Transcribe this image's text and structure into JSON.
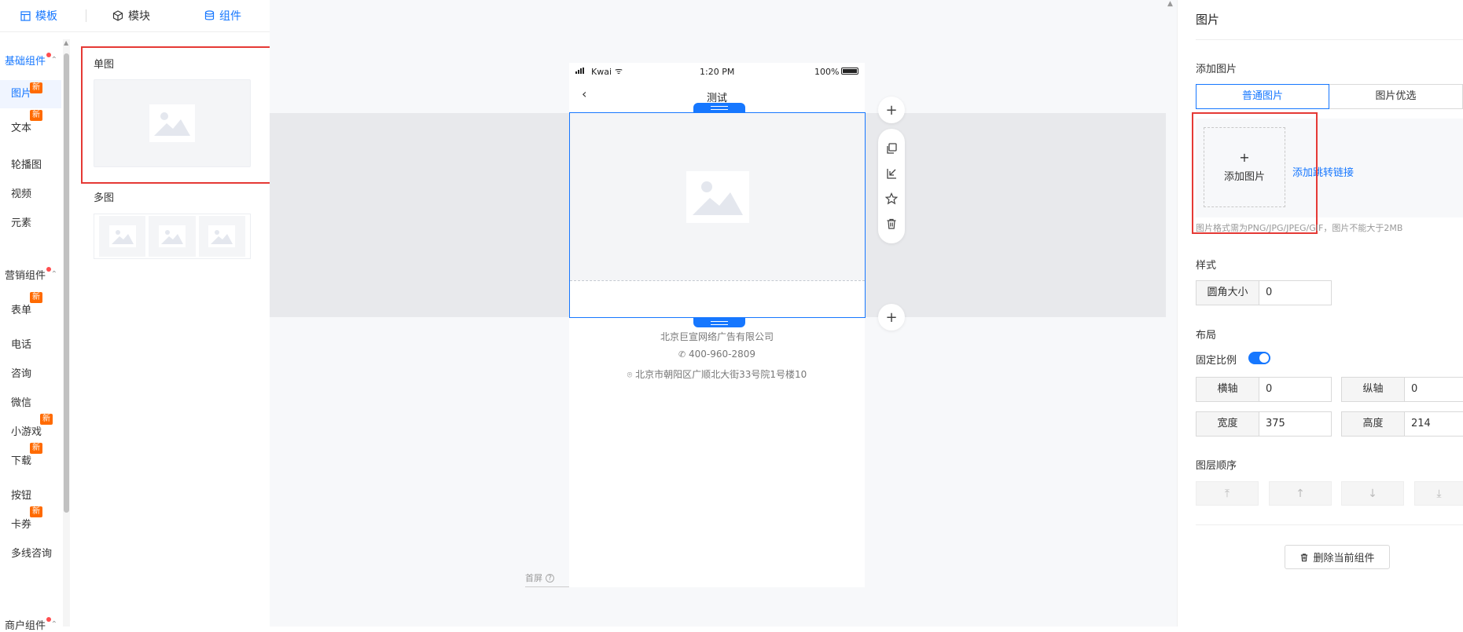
{
  "top_tabs": [
    {
      "label": "模板",
      "icon": "layout-icon"
    },
    {
      "label": "模块",
      "icon": "cube-icon"
    },
    {
      "label": "组件",
      "icon": "database-icon"
    }
  ],
  "left_nav": {
    "group1": "基础组件",
    "items1": [
      {
        "label": "图片",
        "badge": "新"
      },
      {
        "label": "文本",
        "badge": "新"
      },
      {
        "label": "轮播图"
      },
      {
        "label": "视频"
      },
      {
        "label": "元素"
      }
    ],
    "group2": "营销组件",
    "items2": [
      {
        "label": "表单",
        "badge": "新"
      },
      {
        "label": "电话"
      },
      {
        "label": "咨询"
      },
      {
        "label": "微信"
      },
      {
        "label": "小游戏",
        "badge": "新"
      },
      {
        "label": "下载",
        "badge": "新"
      },
      {
        "label": "按钮"
      },
      {
        "label": "卡券",
        "badge": "新"
      },
      {
        "label": "多线咨询"
      }
    ],
    "group3": "商户组件"
  },
  "component_panel": {
    "single_title": "单图",
    "multi_title": "多图"
  },
  "phone": {
    "carrier": "Kwai",
    "time": "1:20 PM",
    "battery": "100%",
    "page_title": "测试",
    "company": "北京巨宣网络广告有限公司",
    "phone_number": "400-960-2809",
    "address": "北京市朝阳区广顺北大街33号院1号楼10"
  },
  "canvas": {
    "first_screen": "首屏"
  },
  "right_panel": {
    "title": "图片",
    "add_image_section": "添加图片",
    "seg_normal": "普通图片",
    "seg_optimized": "图片优选",
    "upload_plus": "+",
    "upload_label": "添加图片",
    "add_link": "添加跳转链接",
    "hint": "图片格式需为PNG/JPG/JPEG/GIF，图片不能大于2MB",
    "style_section": "样式",
    "radius_label": "圆角大小",
    "radius_value": "0",
    "layout_section": "布局",
    "fixed_ratio_label": "固定比例",
    "fixed_ratio_on": true,
    "x_label": "横轴",
    "x_value": "0",
    "y_label": "纵轴",
    "y_value": "0",
    "width_label": "宽度",
    "width_value": "375",
    "height_label": "高度",
    "height_value": "214",
    "layer_section": "图层顺序",
    "delete_label": "删除当前组件"
  },
  "colors": {
    "accent": "#1677ff",
    "badge": "#ff6a00",
    "highlight_box": "#e53935"
  }
}
